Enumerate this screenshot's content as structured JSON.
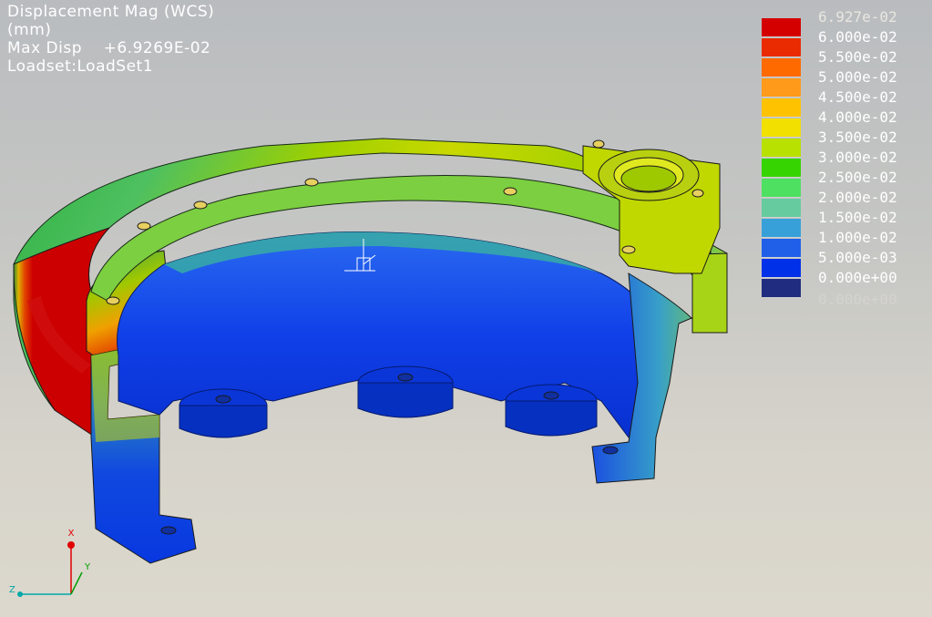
{
  "header": {
    "line1": "Displacement Mag (WCS)",
    "line2": "(mm)",
    "line3": "Max Disp    +6.9269E-02",
    "line4": "Loadset:LoadSet1"
  },
  "legend": {
    "top_label": "6.927e-02",
    "bottom_label": "0.000e+00",
    "items": [
      {
        "label": "6.000e-02",
        "color": "#d40000"
      },
      {
        "label": "5.500e-02",
        "color": "#ea2a00"
      },
      {
        "label": "5.000e-02",
        "color": "#ff6a00"
      },
      {
        "label": "4.500e-02",
        "color": "#ff9a1a"
      },
      {
        "label": "4.000e-02",
        "color": "#ffc200"
      },
      {
        "label": "3.500e-02",
        "color": "#f2e000"
      },
      {
        "label": "3.000e-02",
        "color": "#b8e000"
      },
      {
        "label": "2.500e-02",
        "color": "#36d400"
      },
      {
        "label": "2.000e-02",
        "color": "#4ee060"
      },
      {
        "label": "1.500e-02",
        "color": "#66cca0"
      },
      {
        "label": "1.000e-02",
        "color": "#38a0d8"
      },
      {
        "label": "5.000e-03",
        "color": "#2060e8"
      },
      {
        "label": "0.000e+00",
        "color": "#0030e8"
      },
      {
        "label": "",
        "color": "#202c80"
      }
    ]
  },
  "triad": {
    "x_label": "X",
    "y_label": "Y",
    "z_label": "Z"
  },
  "csys_marker": {
    "label": "Z"
  }
}
